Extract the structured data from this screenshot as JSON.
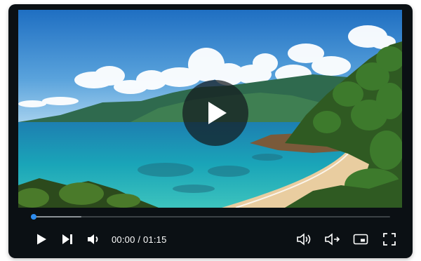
{
  "player": {
    "current_time": "00:00",
    "separator": " / ",
    "duration": "01:15",
    "progress_fraction": 0,
    "buffered_fraction": 0.14
  },
  "controls": {
    "icons": [
      "play-icon",
      "skip-next-icon",
      "volume-icon",
      "audio-track-icon",
      "subtitle-icon",
      "picture-in-picture-icon",
      "fullscreen-icon"
    ]
  },
  "colors": {
    "player_background": "#0b1014",
    "accent": "#2d8cf0",
    "icon": "#ffffff",
    "overlay": "#141a1e"
  }
}
